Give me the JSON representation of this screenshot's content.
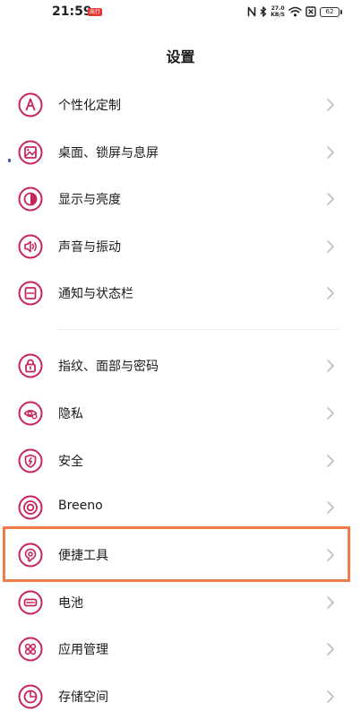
{
  "status_bar": {
    "time": "21:59",
    "badge": "出行",
    "net_speed_value": "27.0",
    "net_speed_unit": "KB/S",
    "battery_level": "62",
    "icons": [
      "nfc-icon",
      "bluetooth-icon",
      "wifi-icon",
      "sim-icon",
      "battery-icon"
    ]
  },
  "header": {
    "title": "设置"
  },
  "settings": {
    "group1": [
      {
        "label": "个性化定制",
        "icon": "personalize-icon"
      },
      {
        "label": "桌面、锁屏与息屏",
        "icon": "wallpaper-icon"
      },
      {
        "label": "显示与亮度",
        "icon": "brightness-icon"
      },
      {
        "label": "声音与振动",
        "icon": "sound-icon"
      },
      {
        "label": "通知与状态栏",
        "icon": "notification-icon"
      }
    ],
    "group2": [
      {
        "label": "指纹、面部与密码",
        "icon": "lock-icon"
      },
      {
        "label": "隐私",
        "icon": "privacy-eye-icon"
      },
      {
        "label": "安全",
        "icon": "shield-icon"
      },
      {
        "label": "Breeno",
        "icon": "breeno-icon"
      },
      {
        "label": "便捷工具",
        "icon": "tools-icon"
      },
      {
        "label": "电池",
        "icon": "battery-icon"
      },
      {
        "label": "应用管理",
        "icon": "apps-icon"
      },
      {
        "label": "存储空间",
        "icon": "storage-icon"
      }
    ]
  },
  "colors": {
    "icon_accent": "#c8245a",
    "highlight": "#f07c45",
    "chevron": "#bdbdbd"
  }
}
